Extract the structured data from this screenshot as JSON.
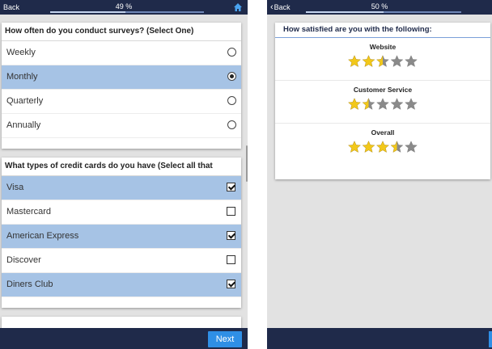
{
  "left_screen": {
    "back_label": "Back",
    "progress_text": "49 %",
    "progress_value": 49,
    "question1": {
      "title": "How often do you conduct surveys? (Select One)",
      "options": [
        {
          "label": "Weekly",
          "selected": false
        },
        {
          "label": "Monthly",
          "selected": true
        },
        {
          "label": "Quarterly",
          "selected": false
        },
        {
          "label": "Annually",
          "selected": false
        }
      ]
    },
    "question2": {
      "title": "What types of credit cards do you have (Select all that",
      "options": [
        {
          "label": "Visa",
          "checked": true
        },
        {
          "label": "Mastercard",
          "checked": false
        },
        {
          "label": "American Express",
          "checked": true
        },
        {
          "label": "Discover",
          "checked": false
        },
        {
          "label": "Diners Club",
          "checked": true
        }
      ]
    },
    "next_label": "Next"
  },
  "right_screen": {
    "back_label": "Back",
    "progress_text": "50 %",
    "progress_value": 50,
    "title": "How satisfied are you with the following:",
    "ratings": [
      {
        "label": "Website",
        "stars": 2.5,
        "max": 5
      },
      {
        "label": "Customer Service",
        "stars": 1.5,
        "max": 5
      },
      {
        "label": "Overall",
        "stars": 3.5,
        "max": 5
      }
    ]
  },
  "colors": {
    "top_bar": "#1f2a4a",
    "selected_row": "#a6c3e5",
    "accent_button": "#2f8fe6",
    "star_filled": "#f2c81a",
    "star_empty": "#8a8a8a"
  },
  "icons": {
    "home": "home-icon",
    "back": "chevron-left-icon",
    "star": "star-icon"
  }
}
